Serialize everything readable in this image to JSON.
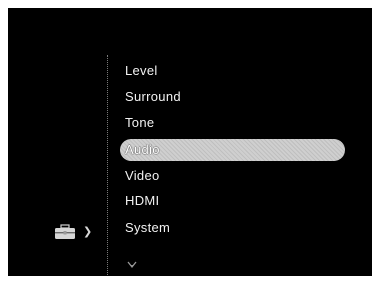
{
  "menu": {
    "items": [
      {
        "label": "Level"
      },
      {
        "label": "Surround"
      },
      {
        "label": "Tone"
      },
      {
        "label": "Audio",
        "selected": true
      },
      {
        "label": "Video"
      },
      {
        "label": "HDMI"
      },
      {
        "label": "System"
      }
    ]
  },
  "icons": {
    "category": "toolbox-icon",
    "pointer": "chevron-right-icon",
    "more": "chevron-down-icon"
  },
  "colors": {
    "background": "#000000",
    "text": "#f2f2f2",
    "highlight": "#cfcfcf"
  }
}
